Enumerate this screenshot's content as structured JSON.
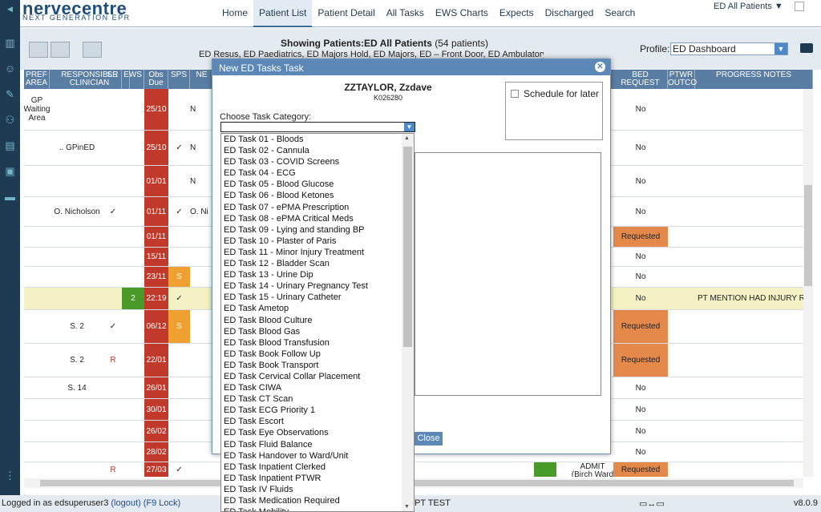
{
  "app": {
    "logo_main": "nervecentre",
    "logo_sub": "NEXT GENERATION EPR"
  },
  "nav": {
    "tabs": [
      "Home",
      "Patient List",
      "Patient Detail",
      "All Tasks",
      "EWS Charts",
      "Expects",
      "Discharged",
      "Search"
    ],
    "active": "Patient List",
    "view_selector": "ED All Patients ▼"
  },
  "toolbar": {
    "showing_label": "Showing Patients:ED All Patients",
    "showing_count": "(54 patients)",
    "showing_areas": "ED Resus, ED Paediatrics, ED Majors Hold, ED Majors, ED – Front Door, ED Ambulatory, A",
    "profile_label": "Profile:",
    "profile_value": "ED Dashboard"
  },
  "grid": {
    "headers": [
      "PREF AREA",
      "RESPONSIBLE CLINICIAN",
      "SR",
      "EWS",
      "Obs Due",
      "SPS",
      "NE",
      "BED REQUEST",
      "PTWR OUTCO",
      "PROGRESS NOTES"
    ],
    "rows": [
      {
        "area": "GP Waiting Area",
        "clin": "",
        "sr": "",
        "ews": "",
        "obs": "25/10",
        "sps": "",
        "bed": "No",
        "bed_req": false,
        "notes": ""
      },
      {
        "area": "",
        "clin": ".. GPinED",
        "sr": "",
        "ews": "",
        "obs": "25/10",
        "sps": "✓",
        "bed": "No",
        "bed_req": false,
        "notes": ""
      },
      {
        "area": "",
        "clin": "",
        "sr": "",
        "ews": "",
        "obs": "01/01",
        "sps": "",
        "bed": "No",
        "bed_req": false,
        "notes": ""
      },
      {
        "area": "",
        "clin": "O. Nicholson",
        "sr": "✓",
        "ews": "",
        "obs": "01/11",
        "sps": "✓",
        "bed": "No",
        "bed_req": false,
        "notes": ""
      },
      {
        "area": "",
        "clin": "",
        "sr": "",
        "ews": "",
        "obs": "01/11",
        "sps": "",
        "bed": "Requested",
        "bed_req": true,
        "notes": ""
      },
      {
        "area": "",
        "clin": "",
        "sr": "",
        "ews": "",
        "obs": "15/11",
        "sps": "",
        "bed": "No",
        "bed_req": false,
        "notes": ""
      },
      {
        "area": "",
        "clin": "",
        "sr": "",
        "ews": "",
        "obs": "23/11",
        "sps": "S",
        "bed": "No",
        "bed_req": false,
        "notes": ""
      },
      {
        "area": "",
        "clin": "",
        "sr": "",
        "ews": "2",
        "obs": "22:19",
        "sps": "✓",
        "bed": "No",
        "bed_req": false,
        "notes": "PT MENTION HAD INJURY REF"
      },
      {
        "area": "",
        "clin": "S. 2",
        "sr": "✓",
        "ews": "",
        "obs": "06/12",
        "sps": "S",
        "bed": "Requested",
        "bed_req": true,
        "notes": ""
      },
      {
        "area": "",
        "clin": "S. 2",
        "sr": "R",
        "ews": "",
        "obs": "22/01",
        "sps": "",
        "bed": "Requested",
        "bed_req": true,
        "notes": ""
      },
      {
        "area": "",
        "clin": "S. 14",
        "sr": "",
        "ews": "",
        "obs": "26/01",
        "sps": "",
        "bed": "No",
        "bed_req": false,
        "notes": ""
      },
      {
        "area": "",
        "clin": "",
        "sr": "",
        "ews": "",
        "obs": "30/01",
        "sps": "",
        "bed": "No",
        "bed_req": false,
        "notes": ""
      },
      {
        "area": "",
        "clin": "",
        "sr": "",
        "ews": "",
        "obs": "26/02",
        "sps": "",
        "bed": "No",
        "bed_req": false,
        "notes": ""
      },
      {
        "area": "",
        "clin": "",
        "sr": "",
        "ews": "",
        "obs": "28/02",
        "sps": "",
        "bed": "No",
        "bed_req": false,
        "notes": ""
      },
      {
        "area": "",
        "clin": "",
        "sr": "R",
        "ews": "",
        "obs": "27/03",
        "sps": "✓",
        "bed": "Requested",
        "bed_req": true,
        "notes": ""
      }
    ],
    "ne_partial": [
      "N",
      "N",
      "N",
      "O. Ni"
    ],
    "admit_text": "ADMIT (Birch Ward"
  },
  "modal": {
    "title": "New ED Tasks Task",
    "patient_name": "ZZTAYLOR, Zzdave",
    "patient_number": "K026280",
    "schedule_label": "Schedule for later",
    "category_label": "Choose Task Category:",
    "close_label": "Close"
  },
  "dropdown": {
    "items": [
      "ED Task 01 - Bloods",
      "ED Task 02 - Cannula",
      "ED Task 03 - COVID Screens",
      "ED Task 04 - ECG",
      "ED Task 05 - Blood Glucose",
      "ED Task 06 - Blood Ketones",
      "ED Task 07 - ePMA Prescription",
      "ED Task 08 - ePMA Critical Meds",
      "ED Task 09 - Lying and standing BP",
      "ED Task 10 - Plaster of Paris",
      "ED Task 11 - Minor Injury Treatment",
      "ED Task 12 - Bladder Scan",
      "ED Task 13 - Urine Dip",
      "ED Task 14 - Urinary Pregnancy Test",
      "ED Task 15 - Urinary Catheter",
      "ED Task Ametop",
      "ED Task Blood Culture",
      "ED Task Blood Gas",
      "ED Task Blood Transfusion",
      "ED Task Book Follow Up",
      "ED Task Book Transport",
      "ED Task Cervical Collar Placement",
      "ED Task CIWA",
      "ED Task CT Scan",
      "ED Task ECG Priority 1",
      "ED Task Escort",
      "ED Task Eye Observations",
      "ED Task Fluid Balance",
      "ED Task Handover to Ward/Unit",
      "ED Task Inpatient Clerked",
      "ED Task Inpatient PTWR",
      "ED Task IV Fluids",
      "ED Task Medication Required",
      "ED Task Mobility"
    ]
  },
  "status": {
    "logged_in": "Logged in as edsuperuser3",
    "logout": "(logout)",
    "lock": "(F9 Lock)",
    "middle": "PT TEST",
    "version": "v8.0.9"
  }
}
